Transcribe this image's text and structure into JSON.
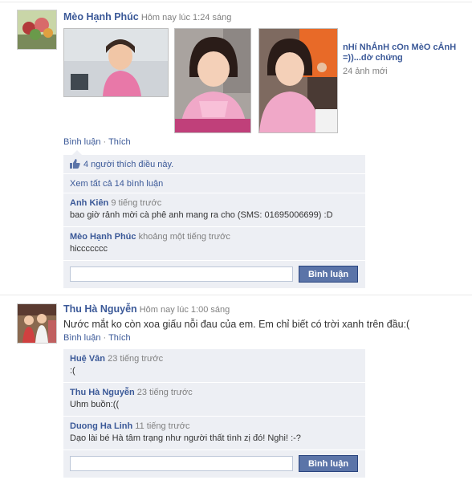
{
  "story1": {
    "actor": "Mèo Hạnh Phúc",
    "time": "Hôm nay lúc 1:24 sáng",
    "album_title": "nHí NhẢnH cOn MèO cẢnH =))...dờ chứng",
    "album_count": "24 ảnh mới",
    "actions": {
      "comment": "Bình luận",
      "sep": "·",
      "like": "Thích"
    },
    "likes": "4 người thích điều này.",
    "view_all": "Xem tất cả 14 bình luận",
    "comments": [
      {
        "author": "Anh Kiên",
        "time": "9 tiếng trước",
        "text": "bao giờ rảnh mời cà phê anh mang ra cho (SMS: 01695006699) :D"
      },
      {
        "author": "Mèo Hạnh Phúc",
        "time": "khoảng một tiếng trước",
        "text": "hiccccccc"
      }
    ],
    "comment_button": "Bình luận"
  },
  "story2": {
    "actor": "Thu Hà Nguyễn",
    "time": "Hôm nay lúc 1:00 sáng",
    "message": "Nước mắt ko còn xoa giấu nỗi đau của em. Em chỉ biết có trời xanh trên đầu:(",
    "actions": {
      "comment": "Bình luận",
      "sep": "·",
      "like": "Thích"
    },
    "comments": [
      {
        "author": "Huệ Vân",
        "time": "23 tiếng trước",
        "text": ":("
      },
      {
        "author": "Thu Hà Nguyễn",
        "time": "23 tiếng trước",
        "text": "Uhm buồn:(("
      },
      {
        "author": "Duong Ha Linh",
        "time": "11 tiếng trước",
        "text": "Dạo lài bé Hà tâm trạng như người thất tình zị đó! Nghi! :-?"
      }
    ],
    "comment_button": "Bình luận"
  },
  "colors": {
    "link": "#3b5998",
    "ufi_bg": "#edeff4",
    "button": "#5b74a8"
  }
}
